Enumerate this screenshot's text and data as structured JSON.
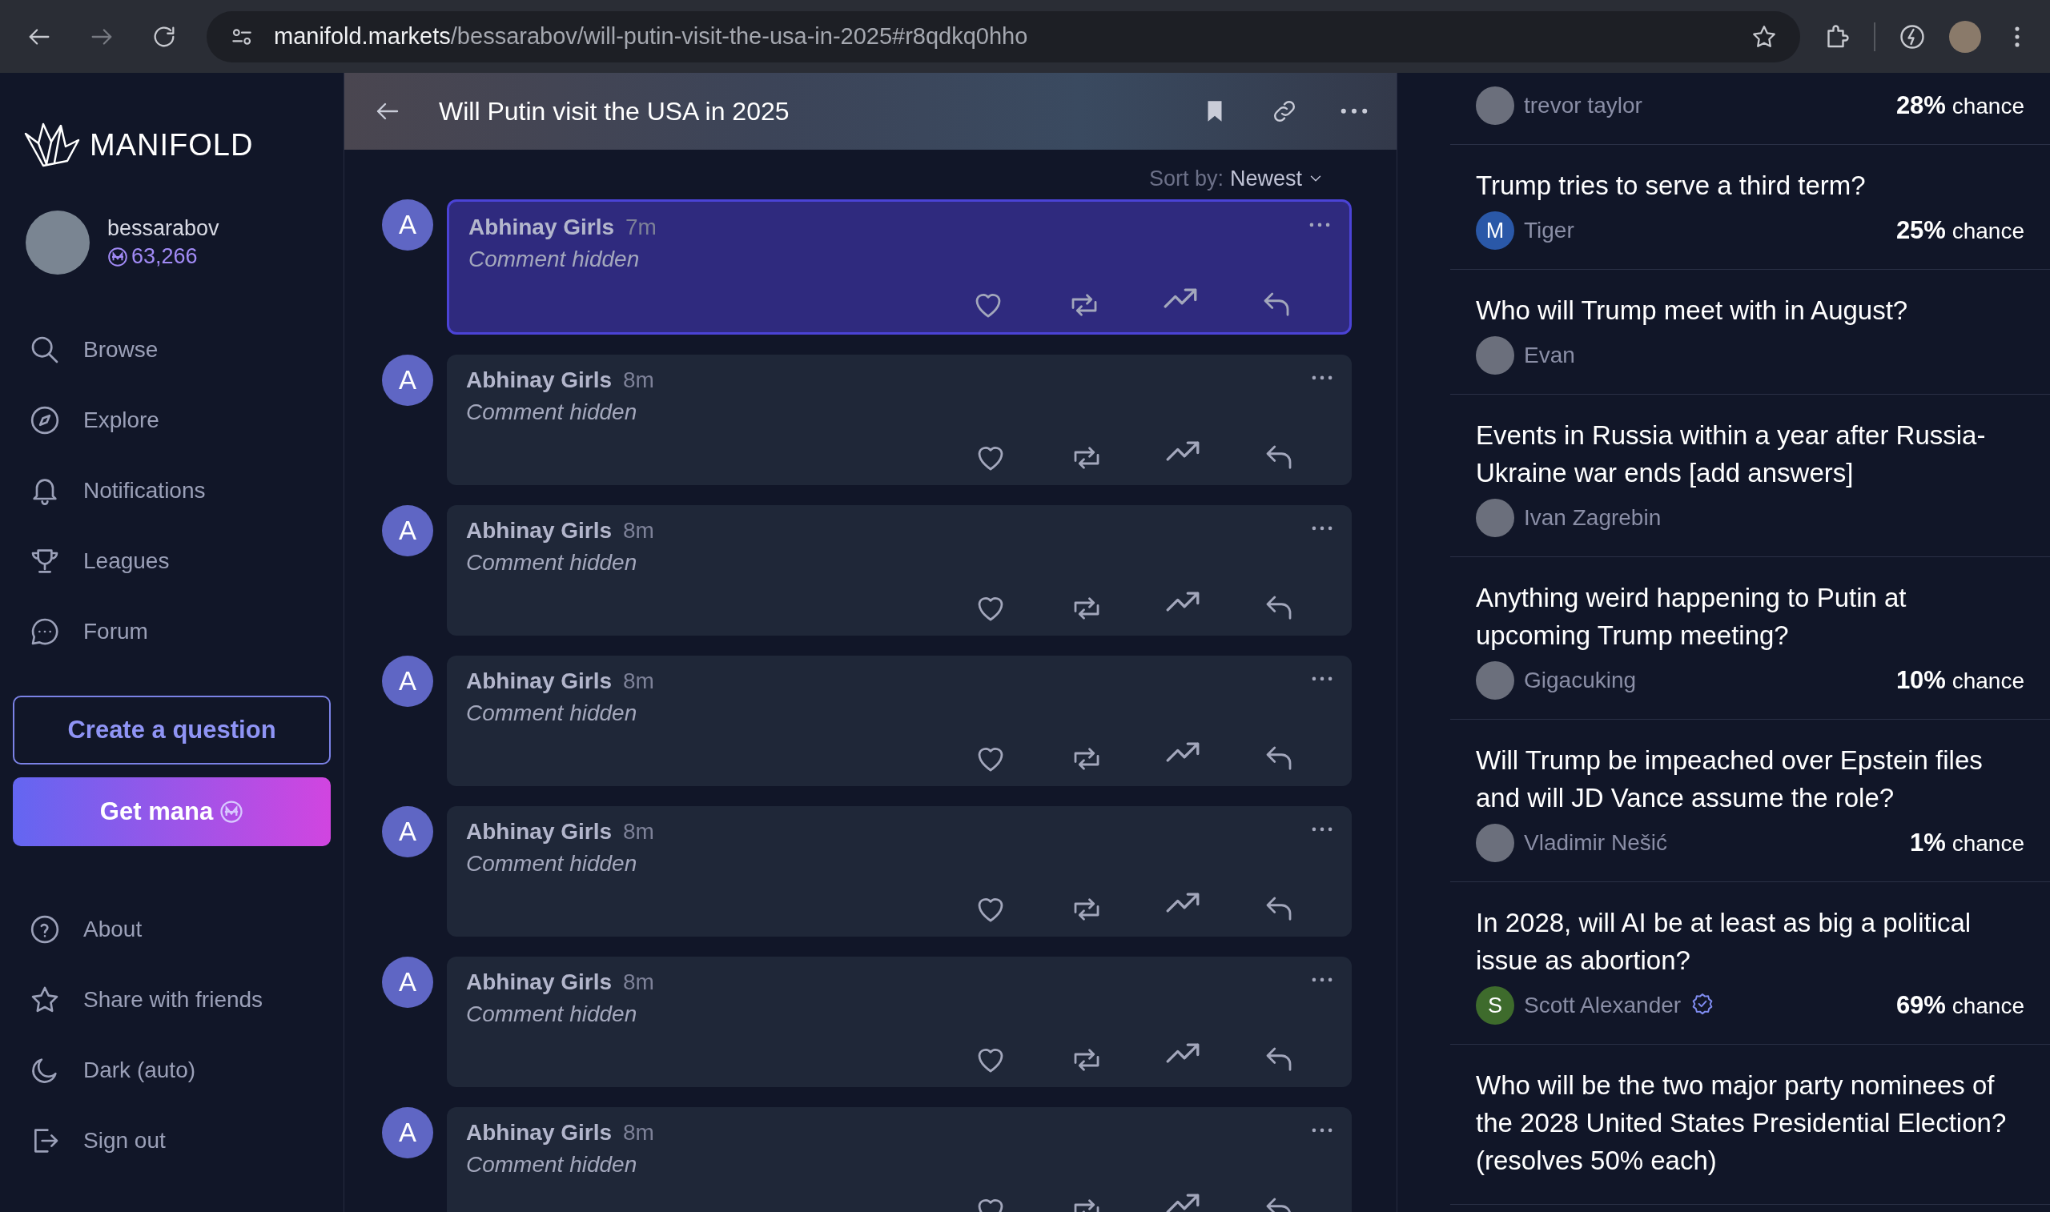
{
  "browser": {
    "url_host": "manifold.markets",
    "url_path": "/bessarabov/will-putin-visit-the-usa-in-2025#r8qdkq0hho"
  },
  "sidebar": {
    "logo": "MANIFOLD",
    "user": {
      "name": "bessarabov",
      "balance": "63,266"
    },
    "nav": [
      {
        "kind": "search",
        "label": "Browse"
      },
      {
        "kind": "compass",
        "label": "Explore"
      },
      {
        "kind": "bell",
        "label": "Notifications"
      },
      {
        "kind": "trophy",
        "label": "Leagues"
      },
      {
        "kind": "chat",
        "label": "Forum"
      }
    ],
    "create_button": "Create a question",
    "mana_button": "Get mana",
    "bottom_nav": [
      {
        "kind": "help",
        "label": "About"
      },
      {
        "kind": "star",
        "label": "Share with friends"
      },
      {
        "kind": "moon",
        "label": "Dark (auto)"
      },
      {
        "kind": "signout",
        "label": "Sign out"
      }
    ]
  },
  "question": {
    "title": "Will Putin visit the USA in 2025",
    "sort_label": "Sort by:",
    "sort_value": "Newest",
    "comments": [
      {
        "avatar": "A",
        "author": "Abhinay Girls",
        "time": "7m",
        "text": "Comment hidden",
        "selected": true
      },
      {
        "avatar": "A",
        "author": "Abhinay Girls",
        "time": "8m",
        "text": "Comment hidden",
        "selected": false
      },
      {
        "avatar": "A",
        "author": "Abhinay Girls",
        "time": "8m",
        "text": "Comment hidden",
        "selected": false
      },
      {
        "avatar": "A",
        "author": "Abhinay Girls",
        "time": "8m",
        "text": "Comment hidden",
        "selected": false
      },
      {
        "avatar": "A",
        "author": "Abhinay Girls",
        "time": "8m",
        "text": "Comment hidden",
        "selected": false
      },
      {
        "avatar": "A",
        "author": "Abhinay Girls",
        "time": "8m",
        "text": "Comment hidden",
        "selected": false
      },
      {
        "avatar": "A",
        "author": "Abhinay Girls",
        "time": "8m",
        "text": "Comment hidden",
        "selected": false
      }
    ]
  },
  "related": [
    {
      "author": "trevor taylor",
      "chance": "**28%** chance"
    },
    {
      "title": "Trump tries to serve a third term?",
      "author": "Tiger",
      "avatar_letter": "M",
      "color": "#2a58a8",
      "chance": "**25%** chance"
    },
    {
      "title": "Who will Trump meet with in August?",
      "author": "Evan"
    },
    {
      "title": "Events in Russia within a year after Russia-Ukraine war ends [add answers]",
      "author": "Ivan Zagrebin"
    },
    {
      "title": "Anything weird happening to Putin at upcoming Trump meeting?",
      "author": "Gigacuking",
      "chance": "**10%** chance"
    },
    {
      "title": "Will Trump be impeached over Epstein files and will JD Vance assume the role?",
      "author": "Vladimir Nešić",
      "chance": "**1%** chance"
    },
    {
      "title": "In 2028, will AI be at least as big a political issue as abortion?",
      "author": "Scott Alexander",
      "avatar_letter": "S",
      "color": "#3e6b2c",
      "verified": true,
      "chance": "**69%** chance"
    },
    {
      "title": "Who will be the two major party nominees of the 2028 United States Presidential Election? (resolves 50% each)"
    }
  ]
}
